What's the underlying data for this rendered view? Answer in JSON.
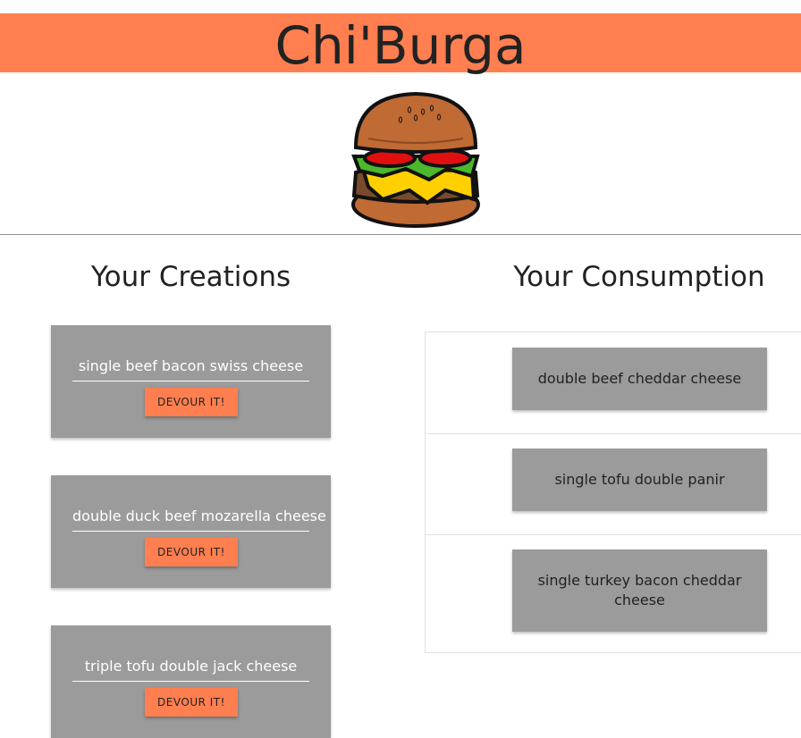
{
  "header": {
    "title": "Chi'Burga",
    "background_color": "#FF7F50",
    "logo_icon": "burger-icon"
  },
  "creations": {
    "title": "Your Creations",
    "items": [
      {
        "name": "single beef bacon swiss cheese",
        "button_label": "DEVOUR IT!"
      },
      {
        "name": "double duck beef mozarella cheese",
        "button_label": "DEVOUR IT!"
      },
      {
        "name": "triple tofu double jack cheese",
        "button_label": "DEVOUR IT!"
      }
    ]
  },
  "consumption": {
    "title": "Your Consumption",
    "items": [
      {
        "name": "double beef cheddar cheese"
      },
      {
        "name": "single tofu double panir"
      },
      {
        "name": "single turkey bacon cheddar cheese"
      }
    ]
  },
  "colors": {
    "accent": "#FF7F50",
    "card": "#9B9B9B"
  }
}
